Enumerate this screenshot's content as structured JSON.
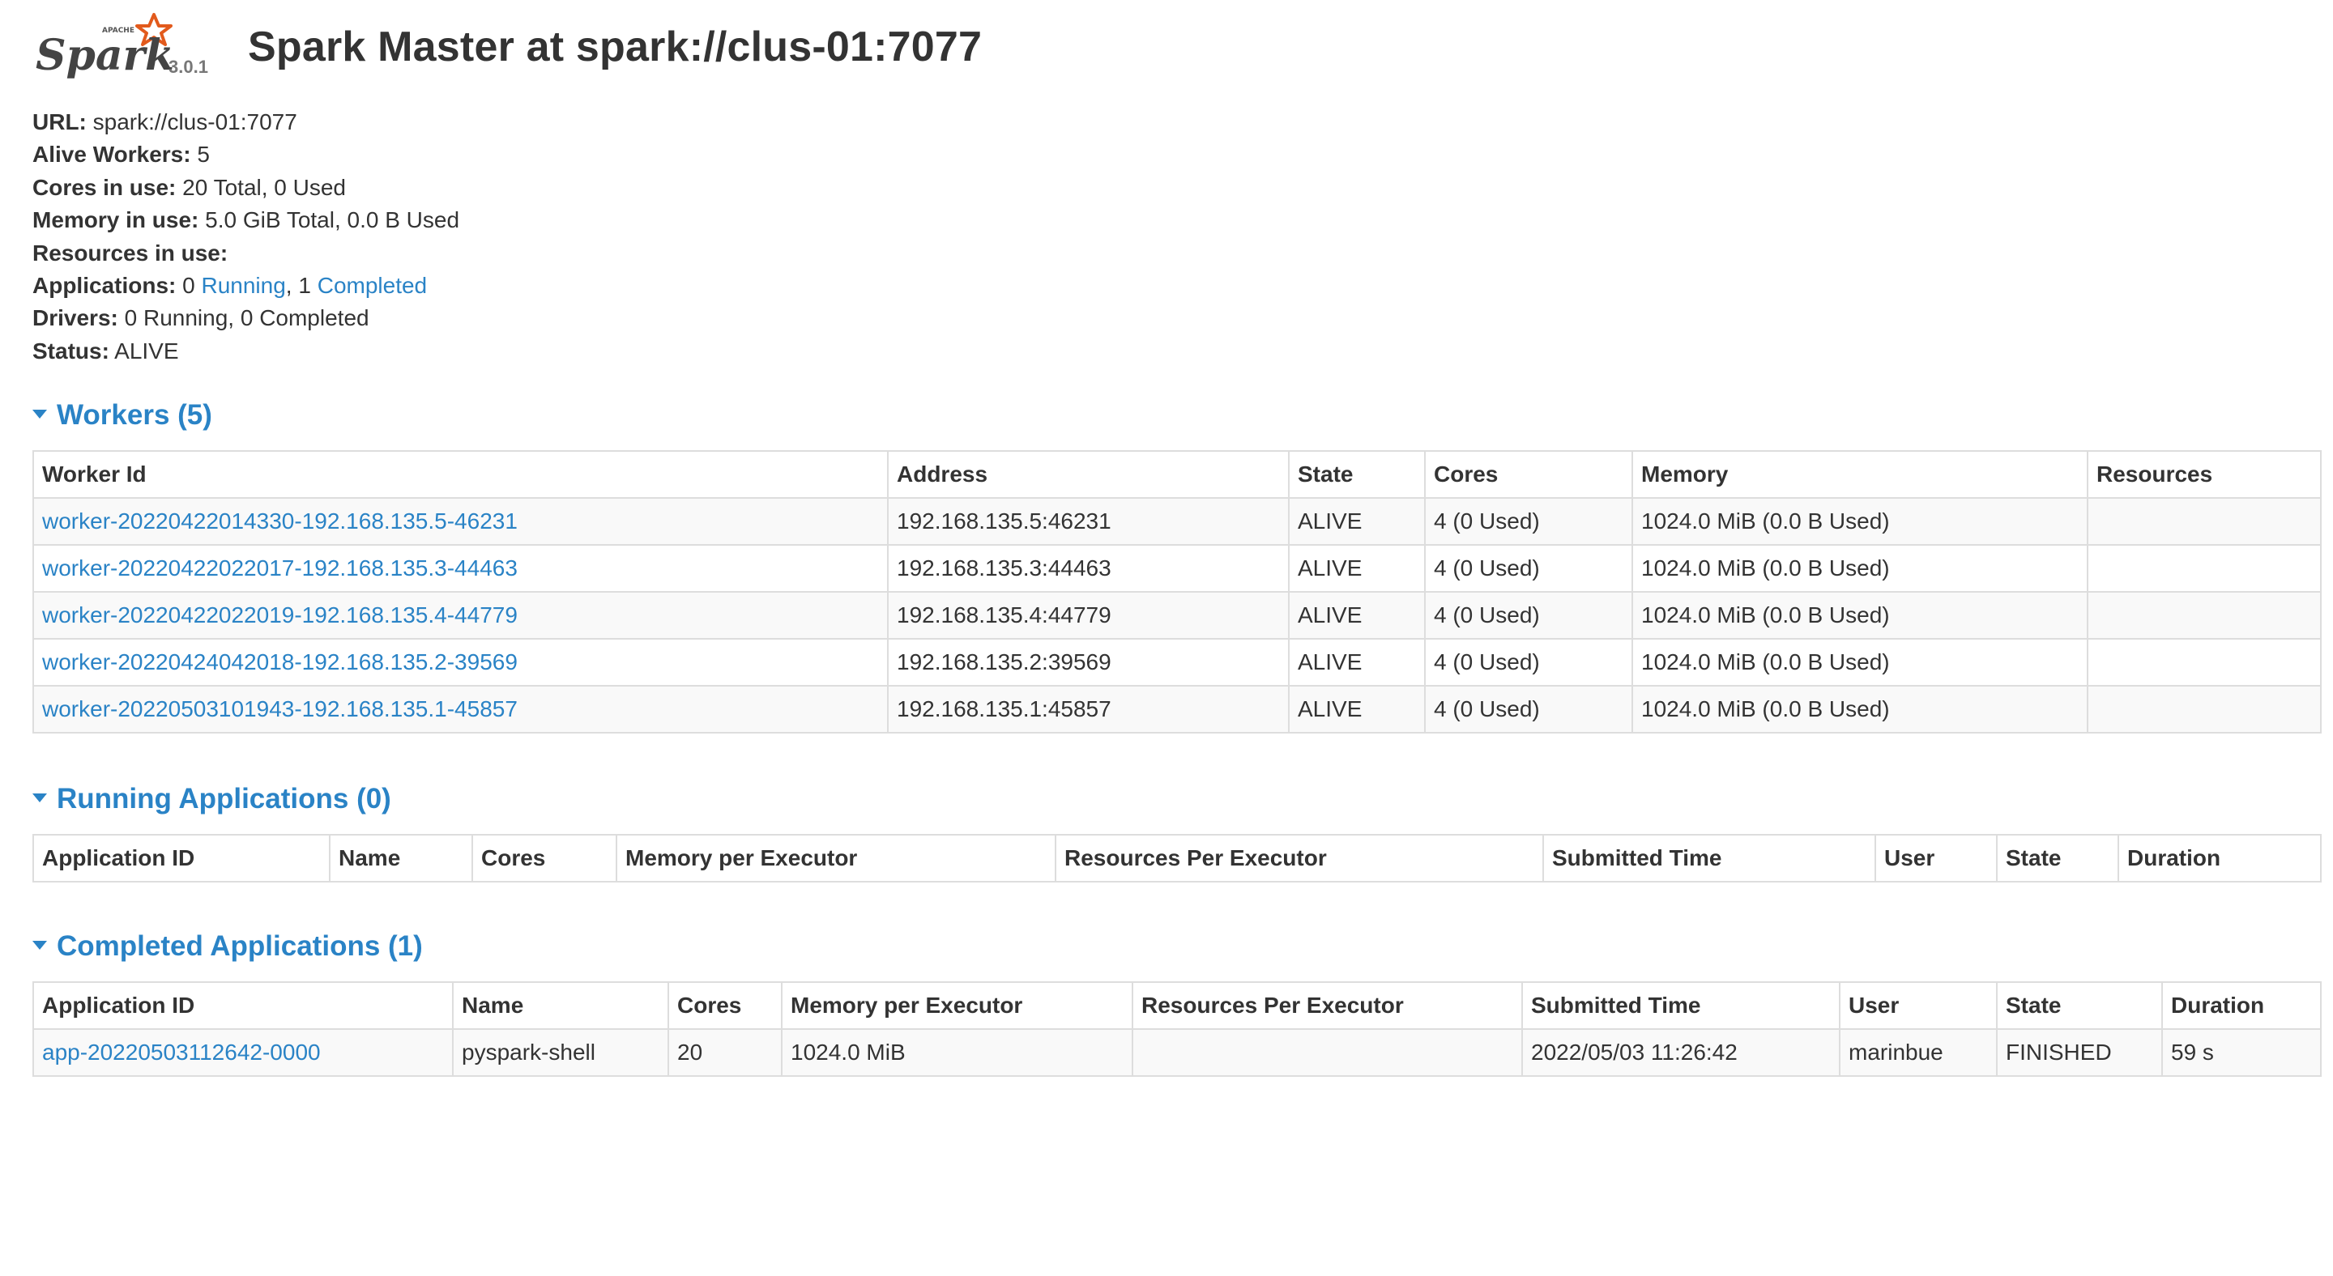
{
  "header": {
    "logo_text": "Spark",
    "logo_apache": "APACHE",
    "version": "3.0.1",
    "title": "Spark Master at spark://clus-01:7077"
  },
  "summary": {
    "url_label": "URL:",
    "url_value": " spark://clus-01:7077",
    "alive_workers_label": "Alive Workers:",
    "alive_workers_value": " 5",
    "cores_label": "Cores in use:",
    "cores_value": " 20 Total, 0 Used",
    "memory_label": "Memory in use:",
    "memory_value": " 5.0 GiB Total, 0.0 B Used",
    "resources_label": "Resources in use:",
    "applications_label": "Applications:",
    "applications_running_count": " 0 ",
    "applications_running_link": "Running",
    "applications_completed_count": ", 1 ",
    "applications_completed_link": "Completed",
    "drivers_label": "Drivers:",
    "drivers_value": " 0 Running, 0 Completed",
    "status_label": "Status:",
    "status_value": " ALIVE"
  },
  "workers": {
    "title": "Workers (5)",
    "columns": [
      "Worker Id",
      "Address",
      "State",
      "Cores",
      "Memory",
      "Resources"
    ],
    "rows": [
      {
        "id": "worker-20220422014330-192.168.135.5-46231",
        "address": "192.168.135.5:46231",
        "state": "ALIVE",
        "cores": "4 (0 Used)",
        "memory": "1024.0 MiB (0.0 B Used)",
        "resources": ""
      },
      {
        "id": "worker-20220422022017-192.168.135.3-44463",
        "address": "192.168.135.3:44463",
        "state": "ALIVE",
        "cores": "4 (0 Used)",
        "memory": "1024.0 MiB (0.0 B Used)",
        "resources": ""
      },
      {
        "id": "worker-20220422022019-192.168.135.4-44779",
        "address": "192.168.135.4:44779",
        "state": "ALIVE",
        "cores": "4 (0 Used)",
        "memory": "1024.0 MiB (0.0 B Used)",
        "resources": ""
      },
      {
        "id": "worker-20220424042018-192.168.135.2-39569",
        "address": "192.168.135.2:39569",
        "state": "ALIVE",
        "cores": "4 (0 Used)",
        "memory": "1024.0 MiB (0.0 B Used)",
        "resources": ""
      },
      {
        "id": "worker-20220503101943-192.168.135.1-45857",
        "address": "192.168.135.1:45857",
        "state": "ALIVE",
        "cores": "4 (0 Used)",
        "memory": "1024.0 MiB (0.0 B Used)",
        "resources": ""
      }
    ]
  },
  "running_apps": {
    "title": "Running Applications (0)",
    "columns": [
      "Application ID",
      "Name",
      "Cores",
      "Memory per Executor",
      "Resources Per Executor",
      "Submitted Time",
      "User",
      "State",
      "Duration"
    ]
  },
  "completed_apps": {
    "title": "Completed Applications (1)",
    "columns": [
      "Application ID",
      "Name",
      "Cores",
      "Memory per Executor",
      "Resources Per Executor",
      "Submitted Time",
      "User",
      "State",
      "Duration"
    ],
    "rows": [
      {
        "id": "app-20220503112642-0000",
        "name": "pyspark-shell",
        "cores": "20",
        "memory": "1024.0 MiB",
        "resources": "",
        "submitted": "2022/05/03 11:26:42",
        "user": "marinbue",
        "state": "FINISHED",
        "duration": "59 s"
      }
    ]
  },
  "colors": {
    "link": "#2a83c6",
    "text": "#333333",
    "logo_orange": "#e25a1c",
    "border": "#dddddd",
    "stripe": "#f9f9f9"
  },
  "icons": {
    "logo": "spark-logo-icon",
    "section_toggle": "caret-down-icon"
  }
}
